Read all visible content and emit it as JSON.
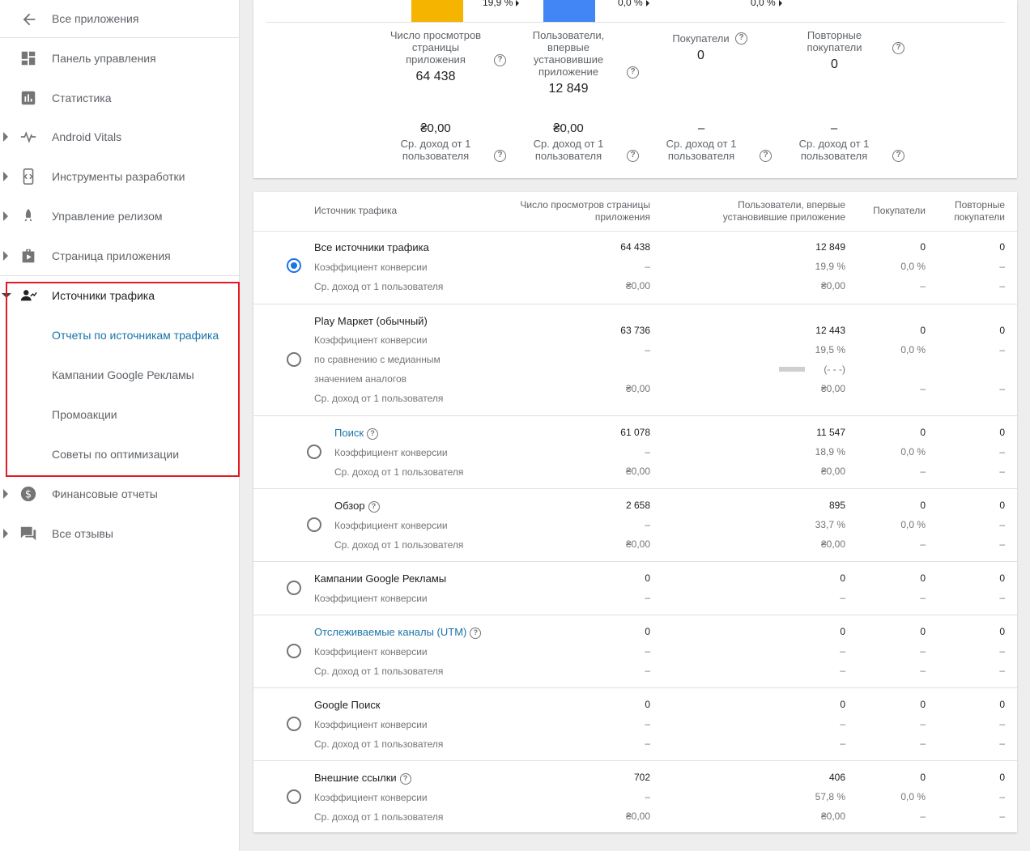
{
  "sidebar": {
    "back_label": "Все приложения",
    "items": [
      {
        "label": "Панель управления",
        "icon": "dashboard-icon"
      },
      {
        "label": "Статистика",
        "icon": "stats-icon"
      },
      {
        "label": "Android Vitals",
        "icon": "vitals-icon"
      },
      {
        "label": "Инструменты разработки",
        "icon": "dev-tools-icon"
      },
      {
        "label": "Управление релизом",
        "icon": "rocket-icon"
      },
      {
        "label": "Страница приложения",
        "icon": "store-listing-icon"
      },
      {
        "label": "Источники трафика",
        "icon": "acquisition-icon"
      },
      {
        "label": "Финансовые отчеты",
        "icon": "dollar-icon"
      },
      {
        "label": "Все отзывы",
        "icon": "reviews-icon"
      }
    ],
    "subitems": [
      {
        "label": "Отчеты по источникам трафика"
      },
      {
        "label": "Кампании Google Рекламы"
      },
      {
        "label": "Промоакции"
      },
      {
        "label": "Советы по оптимизации"
      }
    ]
  },
  "colors": {
    "bar_yellow": "#f4b400",
    "bar_blue": "#4285f4",
    "accent": "#1a73e8",
    "highlight": "#e5191f"
  },
  "funnel": {
    "bar_labels": [
      "19,9 %",
      "0,0 %",
      "0,0 %"
    ],
    "metrics": [
      {
        "label": "Число просмотров страницы приложения",
        "value": "64 438",
        "arpu": "₴0,00",
        "arpu_label": "Ср. доход от 1 пользователя"
      },
      {
        "label": "Пользователи, впервые установившие приложение",
        "value": "12 849",
        "arpu": "₴0,00",
        "arpu_label": "Ср. доход от 1 пользователя"
      },
      {
        "label": "Покупатели",
        "value": "0",
        "arpu": "–",
        "arpu_label": "Ср. доход от 1 пользователя"
      },
      {
        "label": "Повторные покупатели",
        "value": "0",
        "arpu": "–",
        "arpu_label": "Ср. доход от 1 пользователя"
      }
    ]
  },
  "table": {
    "headers": {
      "source": "Источник трафика",
      "views": "Число просмотров страницы приложения",
      "installers": "Пользователи, впервые установившие приложение",
      "buyers": "Покупатели",
      "repeat": "Повторные покупатели"
    },
    "rows": [
      {
        "name": "Все источники трафика",
        "sub1": "Коэффициент конверсии",
        "sub2": "Ср. доход от 1  пользователя",
        "views": [
          "64 438",
          "–",
          "₴0,00"
        ],
        "inst": [
          "12 849",
          "19,9 %",
          "₴0,00"
        ],
        "buy": [
          "0",
          "0,0 %",
          "–"
        ],
        "rep": [
          "0",
          "–",
          "–"
        ]
      },
      {
        "name": "Play Маркет (обычный)",
        "sub1": "Коэффициент конверсии",
        "sub1b": "по сравнению с медианным",
        "sub1c": "значением аналогов",
        "sub2": "Ср. доход от 1  пользователя",
        "views": [
          "63 736",
          "–",
          "₴0,00"
        ],
        "inst": [
          "12 443",
          "19,5 %",
          "(- - -)",
          "₴0,00"
        ],
        "buy": [
          "0",
          "0,0 %",
          "–"
        ],
        "rep": [
          "0",
          "–",
          "–"
        ]
      },
      {
        "name": "Поиск",
        "sub1": "Коэффициент конверсии",
        "sub2": "Ср. доход от 1  пользователя",
        "views": [
          "61 078",
          "–",
          "₴0,00"
        ],
        "inst": [
          "11 547",
          "18,9 %",
          "₴0,00"
        ],
        "buy": [
          "0",
          "0,0 %",
          "–"
        ],
        "rep": [
          "0",
          "–",
          "–"
        ]
      },
      {
        "name": "Обзор",
        "sub1": "Коэффициент конверсии",
        "sub2": "Ср. доход от 1  пользователя",
        "views": [
          "2 658",
          "–",
          "₴0,00"
        ],
        "inst": [
          "895",
          "33,7 %",
          "₴0,00"
        ],
        "buy": [
          "0",
          "0,0 %",
          "–"
        ],
        "rep": [
          "0",
          "–",
          "–"
        ]
      },
      {
        "name": "Кампании Google Рекламы",
        "sub1": "Коэффициент конверсии",
        "views": [
          "0",
          "–"
        ],
        "inst": [
          "0",
          "–"
        ],
        "buy": [
          "0",
          "–"
        ],
        "rep": [
          "0",
          "–"
        ]
      },
      {
        "name": "Отслеживаемые каналы (UTM)",
        "sub1": "Коэффициент конверсии",
        "sub2": "Ср. доход от 1  пользователя",
        "views": [
          "0",
          "–",
          "–"
        ],
        "inst": [
          "0",
          "–",
          "–"
        ],
        "buy": [
          "0",
          "–",
          "–"
        ],
        "rep": [
          "0",
          "–",
          "–"
        ]
      },
      {
        "name": "Google Поиск",
        "sub1": "Коэффициент конверсии",
        "sub2": "Ср. доход от 1  пользователя",
        "views": [
          "0",
          "–",
          "–"
        ],
        "inst": [
          "0",
          "–",
          "–"
        ],
        "buy": [
          "0",
          "–",
          "–"
        ],
        "rep": [
          "0",
          "–",
          "–"
        ]
      },
      {
        "name": "Внешние ссылки",
        "sub1": "Коэффициент конверсии",
        "sub2": "Ср. доход от 1  пользователя",
        "views": [
          "702",
          "–",
          "₴0,00"
        ],
        "inst": [
          "406",
          "57,8 %",
          "₴0,00"
        ],
        "buy": [
          "0",
          "0,0 %",
          "–"
        ],
        "rep": [
          "0",
          "–",
          "–"
        ]
      }
    ]
  }
}
